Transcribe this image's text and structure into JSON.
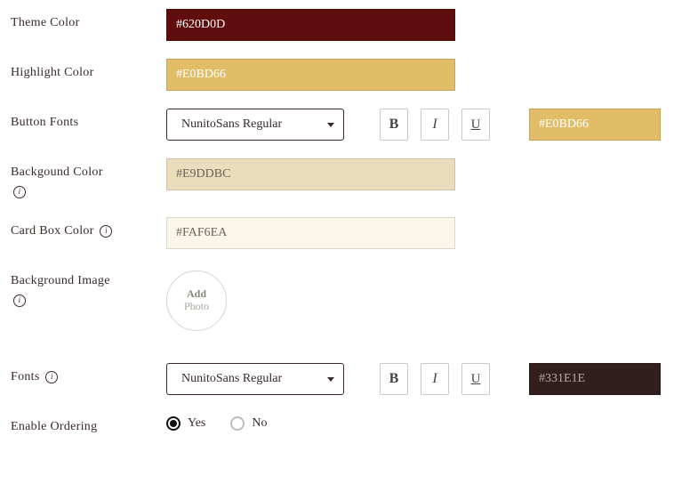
{
  "labels": {
    "theme_color": "Theme Color",
    "highlight_color": "Highlight Color",
    "button_fonts": "Button Fonts",
    "background_color": "Backgound Color",
    "card_box_color": "Card Box Color",
    "background_image": "Background Image",
    "fonts": "Fonts",
    "enable_ordering": "Enable Ordering"
  },
  "values": {
    "theme_color": "#620D0D",
    "highlight_color": "#E0BD66",
    "button_font": "NunitoSans Regular",
    "button_font_color": "#E0BD66",
    "background_color": "#E9DDBC",
    "card_box_color": "#FAF6EA",
    "body_font": "NunitoSans Regular",
    "body_font_color": "#331E1E"
  },
  "add_photo": {
    "line1": "Add",
    "line2": "Photo"
  },
  "enable_ordering": {
    "options": {
      "yes": "Yes",
      "no": "No"
    },
    "selected": "yes"
  },
  "glyph": {
    "info": "i",
    "bold": "B",
    "italic": "I",
    "underline": "U"
  }
}
